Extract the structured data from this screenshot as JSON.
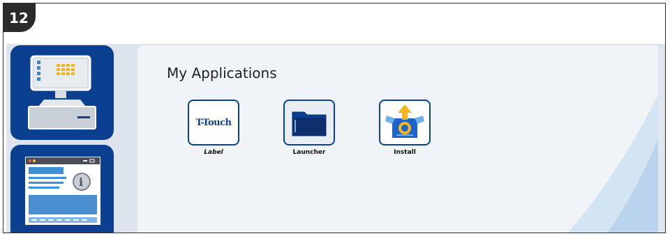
{
  "step": {
    "number": "12"
  },
  "sidebar": {
    "items": [
      {
        "name": "terminal",
        "icon": "pos-terminal-icon"
      },
      {
        "name": "info",
        "icon": "info-window-icon"
      }
    ]
  },
  "main": {
    "title": "My Applications",
    "apps": [
      {
        "label": "Label",
        "tile_text": "T-Touch",
        "icon": "t-touch-icon"
      },
      {
        "label": "Launcher",
        "icon": "folder-icon"
      },
      {
        "label": "Install",
        "icon": "install-box-icon"
      }
    ]
  },
  "colors": {
    "brand_blue": "#0b3f8f",
    "tab_dark": "#2b2b2b",
    "panel_bg": "#f0f3f7",
    "screen_bg": "#dde4ee"
  }
}
